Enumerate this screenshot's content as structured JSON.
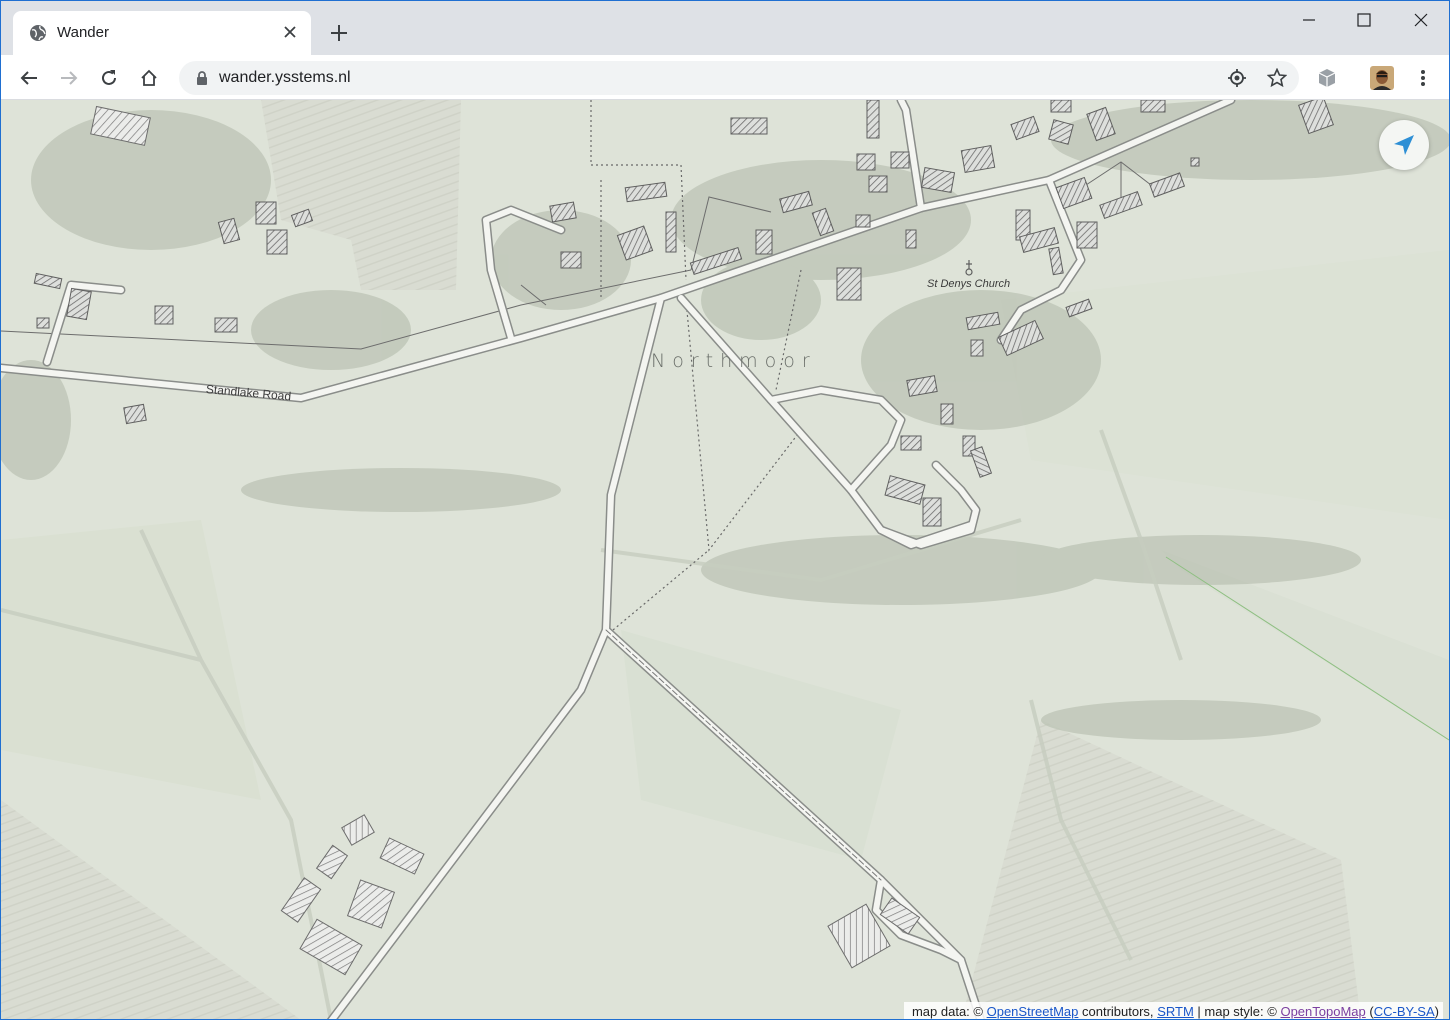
{
  "browser": {
    "tab_title": "Wander",
    "url": "wander.ysstems.nl",
    "colors": {
      "tabstrip": "#dee1e6",
      "toolbar": "#ffffff",
      "omnibox": "#f1f3f4"
    }
  },
  "map": {
    "place_label": "Northmoor",
    "church_label": "St Denys Church",
    "road_label": "Standlake Road",
    "colors": {
      "background": "#d6ddd0",
      "road": "#f4f5f2",
      "road_casing": "#6a6d69",
      "building_hatch": "#444444"
    },
    "locate_icon": "navigation-arrow-icon"
  },
  "attribution": {
    "prefix": "map data: ©",
    "osm": "OpenStreetMap",
    "contributors": "contributors,",
    "srtm": "SRTM",
    "style_prefix": "| map style: ©",
    "otm": "OpenTopoMap",
    "license_open": "(",
    "license": "CC-BY-SA",
    "license_close": ")"
  }
}
